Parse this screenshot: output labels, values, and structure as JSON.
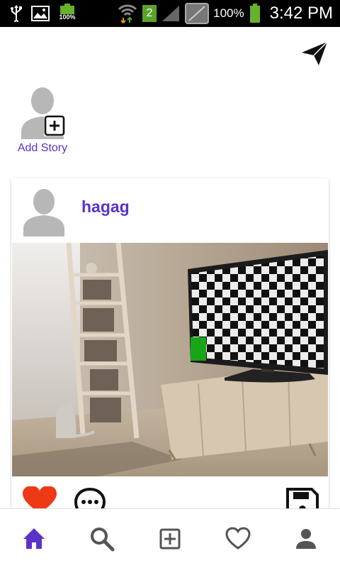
{
  "status_bar": {
    "mini_battery_pct": "100%",
    "sim_label": "2",
    "battery_pct": "100%",
    "time": "3:42 PM"
  },
  "header": {
    "send_icon": "send-icon"
  },
  "stories": {
    "add_label": "Add Story"
  },
  "post": {
    "username": "hagag",
    "image_icon": "living-room-photo"
  },
  "actions": {
    "like_icon": "heart-filled-icon",
    "comment_icon": "comment-icon",
    "save_icon": "save-icon"
  },
  "bottom_nav": {
    "items": [
      "home-icon",
      "search-icon",
      "add-box-icon",
      "heart-outline-icon",
      "person-icon"
    ],
    "active_color": "#5a33c8",
    "inactive_color": "#555555"
  },
  "colors": {
    "accent": "#5a33c8",
    "like": "#ee3a14"
  }
}
